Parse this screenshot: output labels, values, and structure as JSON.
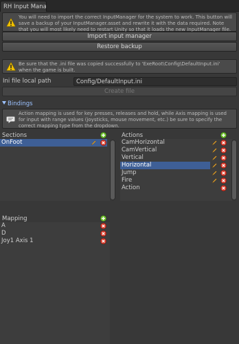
{
  "window": {
    "tab_title": "RH Input Mana"
  },
  "help_top": {
    "text": "You will need to import the correct InputManager for the system to work. This button will save a backup of your InputManager.asset and rewrite it with the data required. Note that you will most likely need to restart Unity so that it loads the new InputManager file."
  },
  "buttons": {
    "import": "Import input manager",
    "restore": "Restore backup",
    "create": "Create file"
  },
  "help_ini": {
    "text": "Be sure that the .ini file was copied successfully to 'ExeRoot\\Config\\DefaultInput.ini' when the game is built."
  },
  "ini": {
    "label": "Ini file local path",
    "value": "Config/DefaultInput.ini"
  },
  "bindings": {
    "foldout_label": "Bindings",
    "help_text": "Action mapping is used for key presses, releases and hold, while Axis mapping is used for input with range values (joysticks, mouse movement, etc.) be sure to specify the correct mapping type from the dropdown."
  },
  "sections": {
    "header": "Sections",
    "items": [
      {
        "label": "OnFoot"
      }
    ]
  },
  "actions": {
    "header": "Actions",
    "items": [
      {
        "label": "CamHorizontal"
      },
      {
        "label": "CamVertical"
      },
      {
        "label": "Vertical"
      },
      {
        "label": "Horizontal"
      },
      {
        "label": "Jump"
      },
      {
        "label": "Fire"
      },
      {
        "label": "Action"
      }
    ]
  },
  "mapping": {
    "header": "Mapping",
    "items": [
      {
        "label": "A"
      },
      {
        "label": "D"
      },
      {
        "label": "Joy1 Axis 1"
      }
    ]
  },
  "colors": {
    "selection": "#3e5f96",
    "add": "#6cc02a",
    "remove": "#d83a2a",
    "edit": "#e0a030",
    "warning": "#f0c000"
  }
}
